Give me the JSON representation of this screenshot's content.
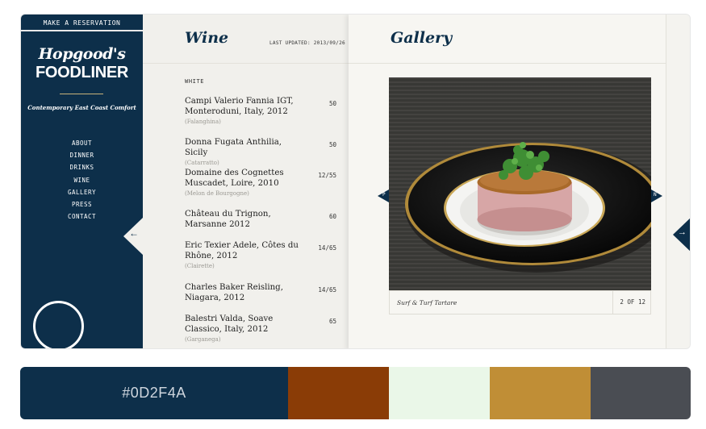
{
  "sidebar": {
    "reserve_label": "MAKE A RESERVATION",
    "logo_script": "Hopgood's",
    "logo_main": "FOODLINER",
    "tagline": "Contemporary East Coast Comfort",
    "nav": [
      "ABOUT",
      "DINNER",
      "DRINKS",
      "WINE",
      "GALLERY",
      "PRESS",
      "CONTACT"
    ],
    "collapse_icon": "arrow-left-icon"
  },
  "wine": {
    "title": "Wine",
    "last_updated": "LAST UPDATED: 2013/09/26",
    "section": "WHITE",
    "items": [
      {
        "name": "Campi Valerio Fannia IGT, Monteroduni, Italy, 2012",
        "grape": "(Falanghina)",
        "price": "50"
      },
      {
        "name": "Donna Fugata Anthilia, Sicily",
        "grape": "(Catarratto)",
        "price": "50"
      },
      {
        "name": "Domaine des Cognettes Muscadet, Loire, 2010",
        "grape": "(Melon de Bourgogne)",
        "price": "12/55"
      },
      {
        "name": "Château du Trignon, Marsanne 2012",
        "grape": "",
        "price": "60"
      },
      {
        "name": "Eric Texier Adele, Côtes du Rhône, 2012",
        "grape": "(Clairette)",
        "price": "14/65"
      },
      {
        "name": "Charles Baker Reisling, Niagara, 2012",
        "grape": "",
        "price": "14/65"
      },
      {
        "name": "Balestri Valda, Soave Classico, Italy, 2012",
        "grape": "(Garganega)",
        "price": "65"
      }
    ]
  },
  "gallery": {
    "title": "Gallery",
    "caption": "Surf & Turf Tartare",
    "counter": "2 OF 12",
    "prev_label": "P",
    "next_label": "N",
    "next_icon": "arrow-right-icon"
  },
  "palette": [
    {
      "hex": "#0D2F4A",
      "label": "#0D2F4A",
      "text_color": "#cfd6de"
    },
    {
      "hex": "#8A3C06",
      "label": ""
    },
    {
      "hex": "#EAF7E8",
      "label": ""
    },
    {
      "hex": "#C08E36",
      "label": ""
    },
    {
      "hex": "#4A4D53",
      "label": ""
    }
  ]
}
